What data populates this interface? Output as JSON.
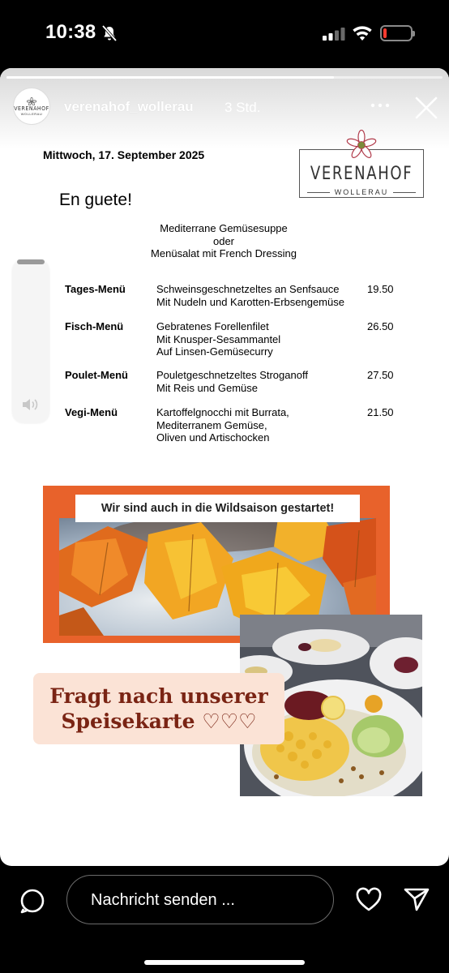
{
  "status_bar": {
    "time": "10:38",
    "battery_level": 0.12,
    "battery_color": "#ff3b30",
    "icons": [
      "bell-muted-icon",
      "cellular-signal-icon",
      "wifi-icon",
      "battery-icon"
    ]
  },
  "story": {
    "username": "verenahof_wollerau",
    "time_ago": "3 Std.",
    "progress": 0.75,
    "avatar": {
      "line1": "VERENAHOF",
      "line2": "WOLLERAU"
    },
    "icons": [
      "more-icon",
      "close-icon"
    ]
  },
  "menu_doc": {
    "date": "Mittwoch, 17. September 2025",
    "logo": {
      "name": "VERENAHOF",
      "sub": "WOLLERAU"
    },
    "greeting": "En guete!",
    "starter": [
      "Mediterrane Gemüsesuppe",
      "oder",
      "Menüsalat mit French Dressing"
    ],
    "items": [
      {
        "name": "Tages-Menü",
        "lines": [
          "Schweinsgeschnetzeltes an Senfsauce",
          "Mit Nudeln und Karotten-Erbsengemüse"
        ],
        "price": "19.50"
      },
      {
        "name": "Fisch-Menü",
        "lines": [
          "Gebratenes Forellenfilet",
          "Mit Knusper-Sesammantel",
          "Auf Linsen-Gemüsecurry"
        ],
        "price": "26.50"
      },
      {
        "name": "Poulet-Menü",
        "lines": [
          "Pouletgeschnetzeltes Stroganoff",
          "Mit Reis und Gemüse"
        ],
        "price": "27.50"
      },
      {
        "name": "Vegi-Menü",
        "lines": [
          "Kartoffelgnocchi mit Burrata,",
          "Mediterranem Gemüse,",
          "Oliven und Artischocken"
        ],
        "price": "21.50"
      }
    ]
  },
  "wild_graphic": {
    "banner": "Wir sind auch in die Wildsaison gestartet!",
    "accent": "#e8622b"
  },
  "promo": {
    "line1": "Fragt nach unserer",
    "line2": "Speisekarte ♡♡♡",
    "text_color": "#7a2414",
    "bg": "#fbe3d6"
  },
  "bottom_bar": {
    "message_placeholder": "Nachricht senden ...",
    "icons": [
      "camera-chat-icon",
      "heart-icon",
      "send-icon"
    ]
  }
}
